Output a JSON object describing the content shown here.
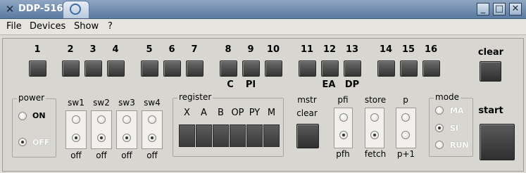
{
  "window": {
    "title": "DDP-516"
  },
  "menu": [
    "File",
    "Devices",
    "Show",
    "?"
  ],
  "switch_numbers": [
    "1",
    "2",
    "3",
    "4",
    "5",
    "6",
    "7",
    "8",
    "9",
    "10",
    "11",
    "12",
    "13",
    "14",
    "15",
    "16"
  ],
  "switch_labels": {
    "s8": "C",
    "s9": "PI",
    "s12": "EA",
    "s13": "DP"
  },
  "clear_label": "clear",
  "start_label": "start",
  "power": {
    "title": "power",
    "on_label": "ON",
    "off_label": "OFF",
    "selected": "OFF"
  },
  "sense_switches": [
    {
      "name": "sw1",
      "state": "off"
    },
    {
      "name": "sw2",
      "state": "off"
    },
    {
      "name": "sw3",
      "state": "off"
    },
    {
      "name": "sw4",
      "state": "off"
    }
  ],
  "register": {
    "title": "register",
    "labels": [
      "X",
      "A",
      "B",
      "OP",
      "PY",
      "M"
    ]
  },
  "mstr": {
    "label": "mstr",
    "button_label": "clear"
  },
  "pfi": {
    "label": "pfi",
    "state": "pfh"
  },
  "store": {
    "label": "store",
    "state": "fetch"
  },
  "p": {
    "label": "p",
    "state": "p+1"
  },
  "mode": {
    "title": "mode",
    "options": [
      "MA",
      "SI",
      "RUN"
    ],
    "selected": "SI"
  }
}
